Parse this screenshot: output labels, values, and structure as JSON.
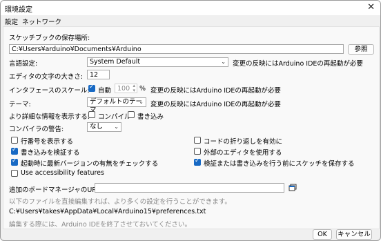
{
  "window": {
    "title": "環境設定",
    "close": "✕"
  },
  "tabs": [
    {
      "label": "設定"
    },
    {
      "label": "ネットワーク"
    }
  ],
  "sketchbook": {
    "label": "スケッチブックの保存場所:",
    "path": "C:¥Users¥arduino¥Documents¥Arduino",
    "browse": "参照"
  },
  "language": {
    "label": "言語設定:",
    "value": "System Default",
    "note": "変更の反映にはArduino IDEの再起動が必要"
  },
  "fontsize": {
    "label": "エディタの文字の大きさ:",
    "value": "12"
  },
  "scale": {
    "label": "インタフェースのスケール:",
    "auto": "自動",
    "value": "100",
    "unit": "%",
    "note": "変更の反映にはArduino IDEの再起動が必要"
  },
  "theme": {
    "label": "テーマ:",
    "value": "デフォルトのテーマ",
    "note": "変更の反映にはArduino IDEの再起動が必要"
  },
  "verbose": {
    "label": "より詳細な情報を表示する:",
    "compile": "コンパイル",
    "upload": "書き込み"
  },
  "warnings": {
    "label": "コンパイラの警告:",
    "value": "なし"
  },
  "options": {
    "line_numbers": "行番号を表示する",
    "verify": "書き込みを検証する",
    "check_updates": "起動時に最新バージョンの有無をチェックする",
    "accessibility": "Use accessibility features",
    "code_folding": "コードの折り返しを有効に",
    "external_editor": "外部のエディタを使用する",
    "save_before": "検証または書き込みを行う前にスケッチを保存する"
  },
  "board_manager": {
    "label": "追加のボードマネージャのURL:",
    "value": ""
  },
  "info": {
    "line1": "以下のファイルを直接編集すれば、より多くの設定を行うことができます。",
    "path": "C:¥Users¥takes¥AppData¥Local¥Arduino15¥preferences.txt",
    "line2": "編集する際には、Arduino IDEを終了させておいてください。"
  },
  "buttons": {
    "ok": "OK",
    "cancel": "キャンセル"
  },
  "colors": {
    "accent": "#1769c4"
  }
}
